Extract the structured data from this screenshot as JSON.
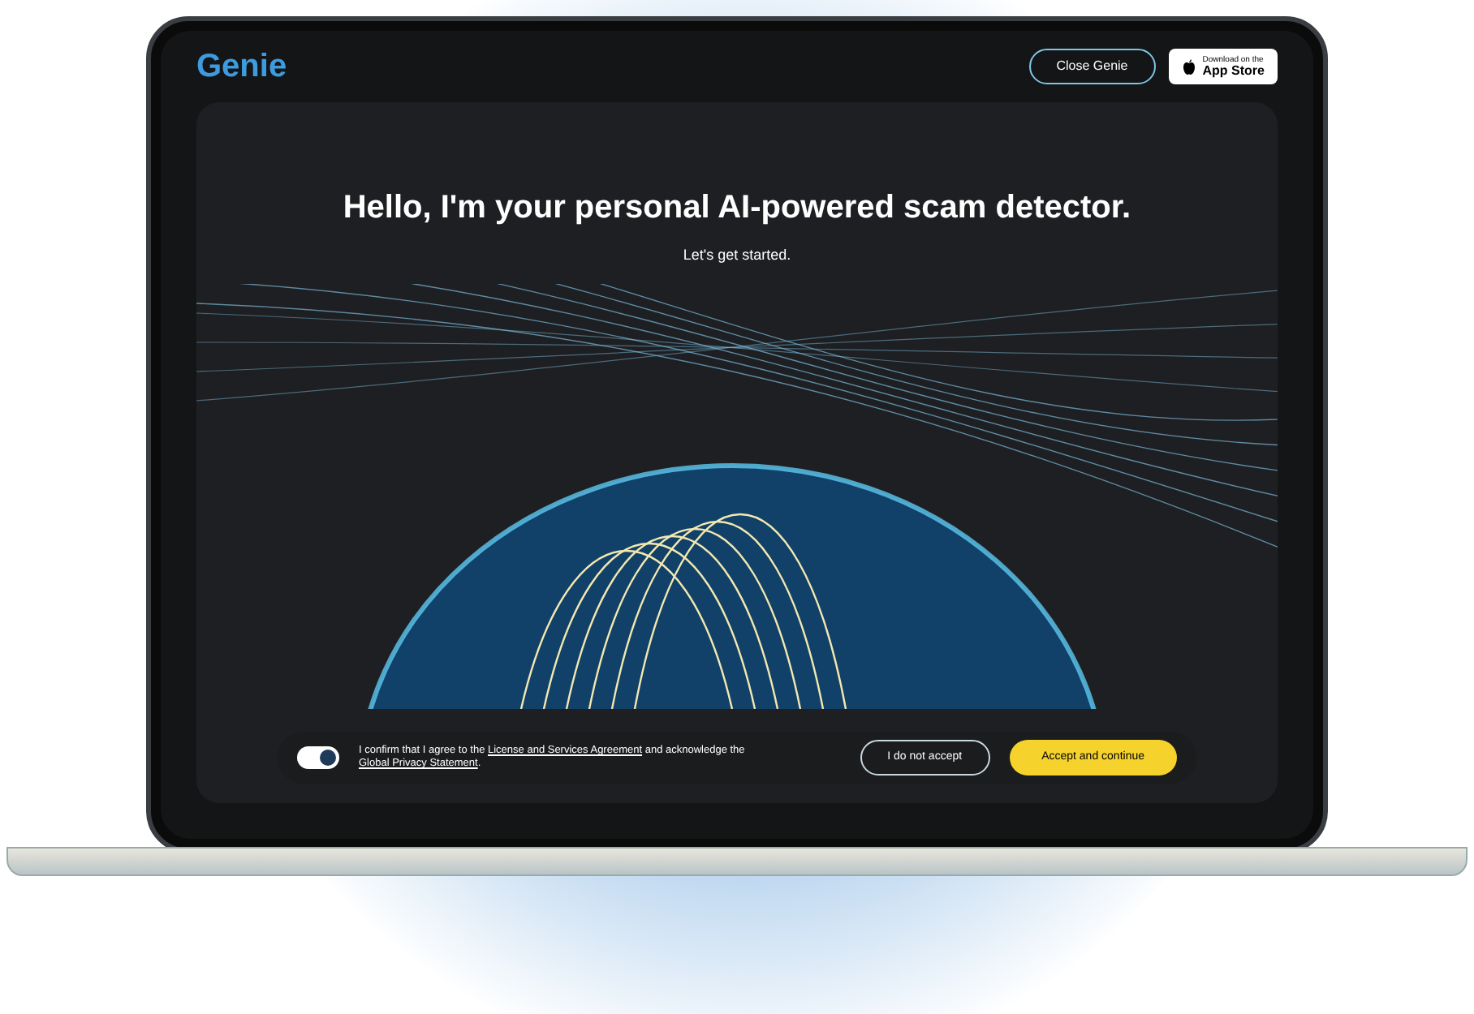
{
  "header": {
    "logo": "Genie",
    "close_button": "Close Genie",
    "store_badge": {
      "line_1": "Download on the",
      "line_2": "App Store"
    }
  },
  "hero": {
    "title": "Hello, I'm your personal AI-powered scam detector.",
    "subtitle": "Let's get started."
  },
  "consent": {
    "toggle_on": true,
    "text_before": "I confirm that I agree to the",
    "link_1": "License and Services Agreement",
    "text_middle": "and acknowledge the",
    "link_2": "Global Privacy Statement",
    "text_after": ".",
    "decline_button": "I do not accept",
    "accept_button": "Accept and continue"
  }
}
